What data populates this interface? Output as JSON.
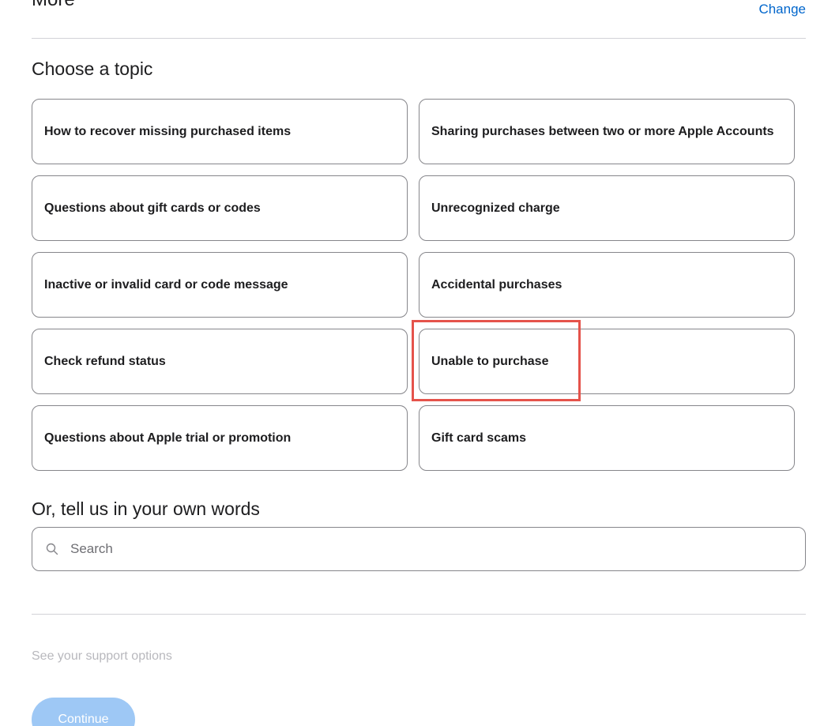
{
  "header": {
    "title": "More",
    "change_label": "Change"
  },
  "topics": {
    "heading": "Choose a topic",
    "items": [
      {
        "label": "How to recover missing purchased items"
      },
      {
        "label": "Sharing purchases between two or more Apple Accounts"
      },
      {
        "label": "Questions about gift cards or codes"
      },
      {
        "label": "Unrecognized charge"
      },
      {
        "label": "Inactive or invalid card or code message"
      },
      {
        "label": "Accidental purchases"
      },
      {
        "label": "Check refund status"
      },
      {
        "label": "Unable to purchase"
      },
      {
        "label": "Questions about Apple trial or promotion"
      },
      {
        "label": "Gift card scams"
      }
    ]
  },
  "own_words": {
    "heading": "Or, tell us in your own words",
    "search_placeholder": "Search",
    "search_value": "",
    "search_icon": "search-icon"
  },
  "footer": {
    "support_options": "See your support options",
    "continue_label": "Continue"
  },
  "colors": {
    "link": "#0066cc",
    "highlight": "#e5534b",
    "button_disabled": "#9ec8f5"
  }
}
